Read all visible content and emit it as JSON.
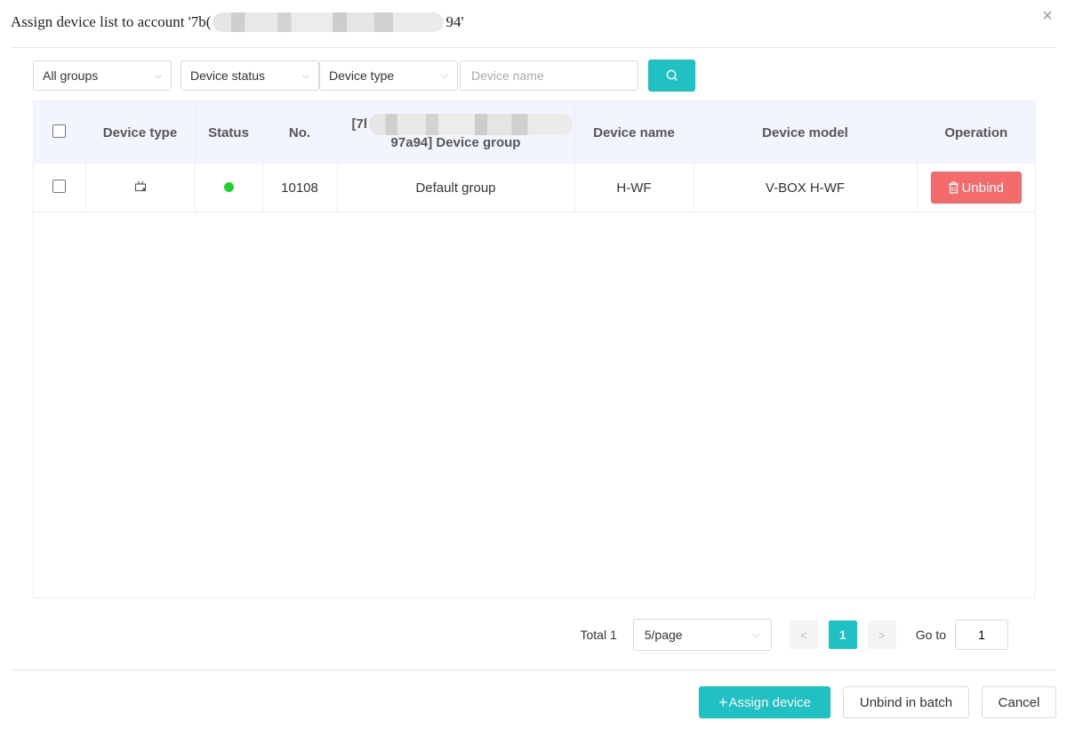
{
  "dialog": {
    "title_prefix": "Assign device list to account '7b(",
    "title_suffix": "94'",
    "close_glyph": "×"
  },
  "filters": {
    "group": "All groups",
    "status": "Device status",
    "type": "Device type",
    "name_placeholder": "Device name"
  },
  "table": {
    "headers": {
      "device_type": "Device type",
      "status": "Status",
      "no": "No.",
      "group_line1": "[7l",
      "group_line2": "97a94] Device group",
      "device_name": "Device name",
      "device_model": "Device model",
      "operation": "Operation"
    },
    "rows": [
      {
        "no": "10108",
        "group": "Default group",
        "device_name": "H-WF",
        "device_model": "V-BOX H-WF",
        "action": "Unbind",
        "status_color": "#1dd42e"
      }
    ]
  },
  "pagination": {
    "total": "Total 1",
    "page_size": "5/page",
    "current_page": "1",
    "goto_label": "Go to",
    "goto_value": "1"
  },
  "footer": {
    "assign_label": "Assign device",
    "batch_unbind_label": "Unbind in batch",
    "cancel_label": "Cancel"
  },
  "colors": {
    "accent": "#1fc1c3",
    "danger": "#f46b6b",
    "online": "#1dd42e"
  }
}
